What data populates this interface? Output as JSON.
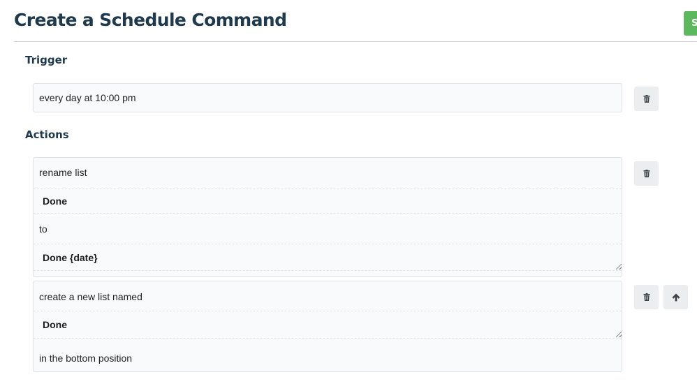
{
  "header": {
    "title": "Create a Schedule Command",
    "save_label": "S"
  },
  "trigger": {
    "heading": "Trigger",
    "value": "every day at 10:00 pm",
    "delete_icon": "trash-icon"
  },
  "actions": {
    "heading": "Actions",
    "items": [
      {
        "rows": [
          "rename list",
          "Done",
          "to",
          "Done {date}"
        ],
        "delete_icon": "trash-icon"
      },
      {
        "rows": [
          "create a new list named",
          "Done",
          "in the bottom position"
        ],
        "delete_icon": "trash-icon",
        "move_up_icon": "arrow-up-icon"
      }
    ]
  },
  "colors": {
    "save_button": "#5cb85c",
    "title": "#1f3a4d",
    "card_background": "#f8fafb",
    "icon_button_background": "#ebedef"
  }
}
